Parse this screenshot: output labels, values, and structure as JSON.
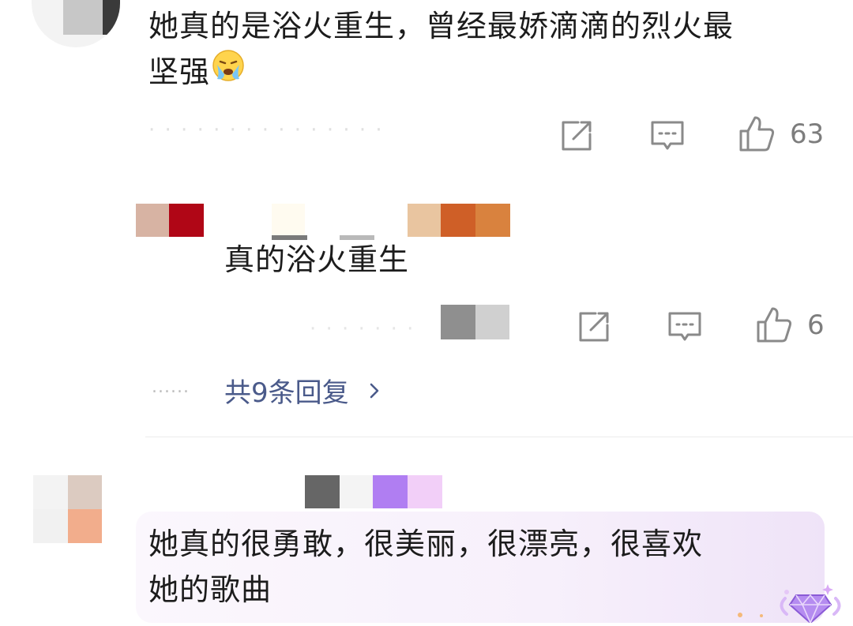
{
  "comments": [
    {
      "text_line1": "她真的是浴火重生，曾经最娇滴滴的烈火最",
      "text_line2": "坚强",
      "emoji": "crying-face",
      "likes": "63",
      "actions": [
        "share-icon",
        "reply-icon",
        "thumbs-up-icon"
      ]
    },
    {
      "text": "真的浴火重生",
      "likes": "6",
      "more_replies": "共9条回复",
      "actions": [
        "share-icon",
        "reply-icon",
        "thumbs-up-icon"
      ]
    },
    {
      "text_line1": "她真的很勇敢，很美丽，很漂亮，很喜欢",
      "text_line2": "她的歌曲",
      "badge": "diamond-badge"
    }
  ],
  "colors": {
    "text": "#1c1c1c",
    "meta": "#8a8a8a",
    "link": "#4a5a8a",
    "card_bg": "#f7f0fb",
    "badge": "#b58cf0"
  }
}
